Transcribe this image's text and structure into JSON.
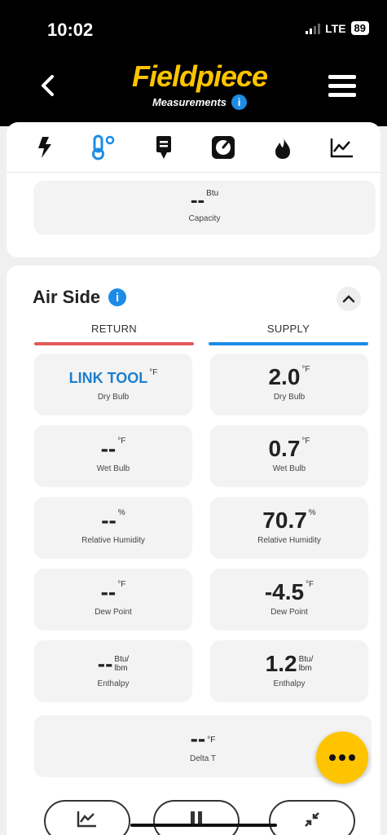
{
  "status": {
    "time": "10:02",
    "network": "LTE",
    "battery": "89"
  },
  "header": {
    "brand": "Fieldpiece",
    "subtitle": "Measurements",
    "info": "i"
  },
  "tabs": [
    {
      "icon": "lightning-icon"
    },
    {
      "icon": "thermometer-icon",
      "active": true
    },
    {
      "icon": "probe-icon"
    },
    {
      "icon": "gauge-icon"
    },
    {
      "icon": "flame-icon"
    },
    {
      "icon": "chart-icon"
    }
  ],
  "capacity": {
    "value": "--",
    "unit": "Btu",
    "label": "Capacity"
  },
  "air_side": {
    "title": "Air Side",
    "return_label": "RETURN",
    "supply_label": "SUPPLY",
    "return": {
      "dry_bulb": {
        "value": "LINK TOOL",
        "unit": "°F",
        "label": "Dry Bulb"
      },
      "wet_bulb": {
        "value": "--",
        "unit": "°F",
        "label": "Wet Bulb"
      },
      "rh": {
        "value": "--",
        "unit": "%",
        "label": "Relative Humidity"
      },
      "dew_point": {
        "value": "--",
        "unit": "°F",
        "label": "Dew Point"
      },
      "enthalpy": {
        "value": "--",
        "unit_top": "Btu/",
        "unit_bottom": "lbm",
        "label": "Enthalpy"
      }
    },
    "supply": {
      "dry_bulb": {
        "value": "2.0",
        "unit": "°F",
        "label": "Dry Bulb"
      },
      "wet_bulb": {
        "value": "0.7",
        "unit": "°F",
        "label": "Wet Bulb"
      },
      "rh": {
        "value": "70.7",
        "unit": "%",
        "label": "Relative Humidity"
      },
      "dew_point": {
        "value": "-4.5",
        "unit": "°F",
        "label": "Dew Point"
      },
      "enthalpy": {
        "value": "1.2",
        "unit_top": "Btu/",
        "unit_bottom": "lbm",
        "label": "Enthalpy"
      }
    },
    "delta_t": {
      "value": "--",
      "unit": "°F",
      "label": "Delta T"
    }
  },
  "colors": {
    "brand": "#ffc400",
    "accent": "#1c8ce6",
    "return": "#e25a5a"
  }
}
